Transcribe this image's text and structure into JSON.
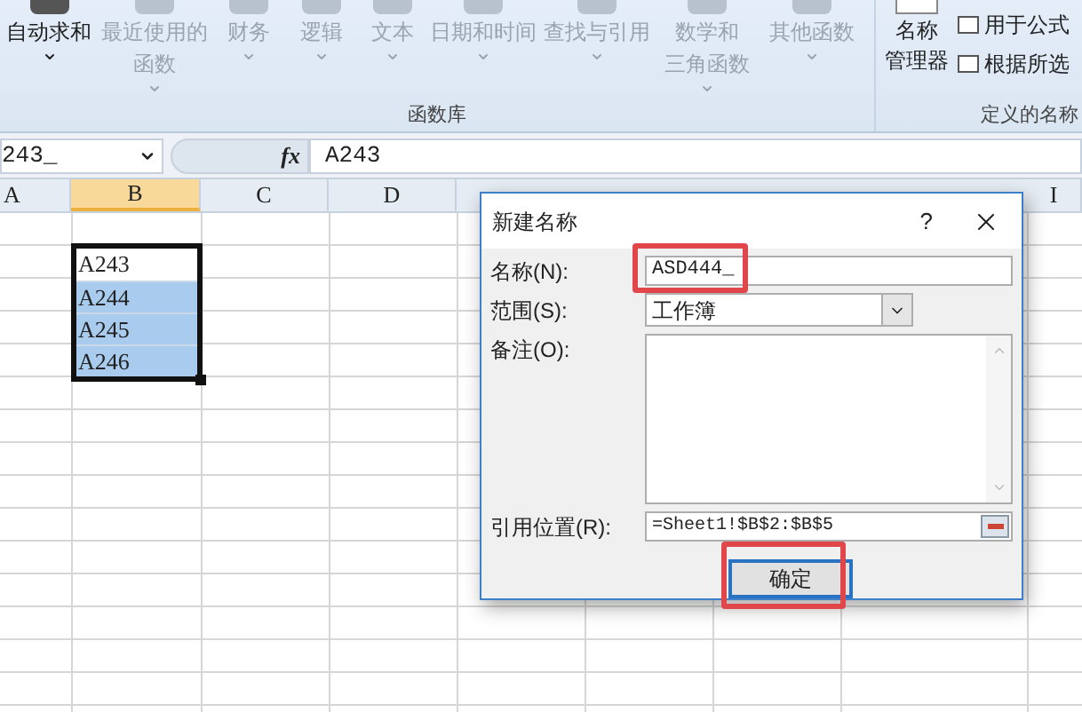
{
  "ribbon": {
    "function_library": {
      "label": "函数库",
      "buttons": [
        {
          "lines": [
            "自动求和"
          ],
          "disabled": false
        },
        {
          "lines": [
            "最近使用的",
            "函数"
          ],
          "disabled": true
        },
        {
          "lines": [
            "财务"
          ],
          "disabled": true
        },
        {
          "lines": [
            "逻辑"
          ],
          "disabled": true
        },
        {
          "lines": [
            "文本"
          ],
          "disabled": true
        },
        {
          "lines": [
            "日期和时间"
          ],
          "disabled": true
        },
        {
          "lines": [
            "查找与引用"
          ],
          "disabled": true
        },
        {
          "lines": [
            "数学和",
            "三角函数"
          ],
          "disabled": true
        },
        {
          "lines": [
            "其他函数"
          ],
          "disabled": true
        }
      ]
    },
    "defined_names": {
      "label": "定义的名称",
      "manager": [
        "名称",
        "管理器"
      ],
      "items": [
        "用于公式",
        "根据所选"
      ]
    }
  },
  "formula_bar": {
    "name_box": "243_",
    "fx": "fx",
    "formula": "A243"
  },
  "columns": [
    {
      "label": "A",
      "selected": false
    },
    {
      "label": "B",
      "selected": true
    },
    {
      "label": "C",
      "selected": false
    },
    {
      "label": "D",
      "selected": false
    },
    {
      "label": "I",
      "selected": false
    }
  ],
  "cells": [
    {
      "text": "A243",
      "selected": false
    },
    {
      "text": "A244",
      "selected": true
    },
    {
      "text": "A245",
      "selected": true
    },
    {
      "text": "A246",
      "selected": true
    }
  ],
  "dialog": {
    "title": "新建名称",
    "help": "?",
    "name_label": "名称(N):",
    "name_value": "ASD444_",
    "scope_label": "范围(S):",
    "scope_value": "工作簿",
    "comment_label": "备注(O):",
    "ref_label": "引用位置(R):",
    "ref_value": "=Sheet1!$B$2:$B$5",
    "ok": "确定"
  }
}
